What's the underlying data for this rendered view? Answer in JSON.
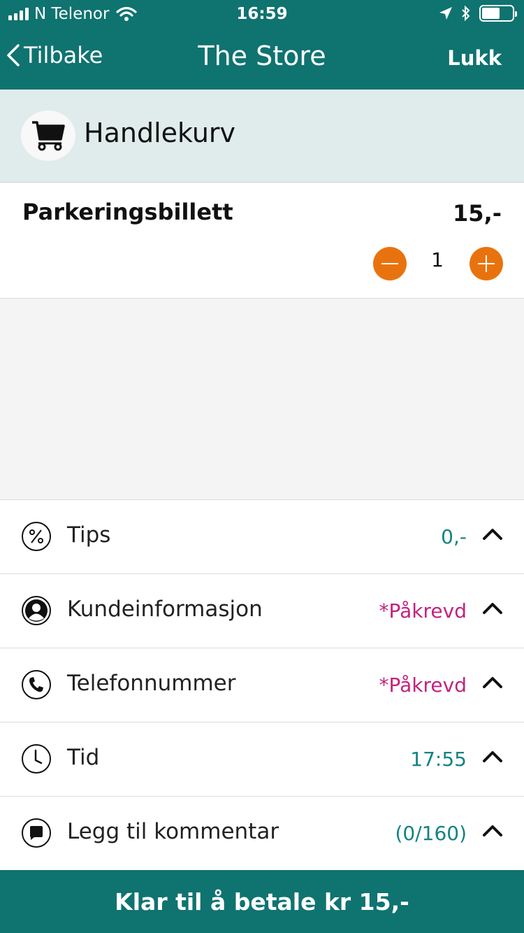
{
  "status_bar": {
    "carrier": "N Telenor",
    "time": "16:59",
    "battery_level": 0.6
  },
  "nav": {
    "back_label": "Tilbake",
    "title": "The Store",
    "close_label": "Lukk"
  },
  "cart": {
    "title": "Handlekurv",
    "icon": "shopping-cart-icon"
  },
  "item": {
    "name": "Parkeringsbillett",
    "price": "15,-",
    "quantity": "1"
  },
  "options": [
    {
      "label": "Tips",
      "value": "0,-",
      "value_color": "teal",
      "icon": "percent-icon"
    },
    {
      "label": "Kundeinformasjon",
      "value": "*Påkrevd",
      "value_color": "pink",
      "icon": "user-icon"
    },
    {
      "label": "Telefonnummer",
      "value": "*Påkrevd",
      "value_color": "pink",
      "icon": "phone-icon"
    },
    {
      "label": "Tid",
      "value": "17:55",
      "value_color": "teal",
      "icon": "clock-icon"
    },
    {
      "label": "Legg til kommentar",
      "value": "(0/160)",
      "value_color": "teal",
      "icon": "comment-icon"
    }
  ],
  "pay_button": {
    "label": "Klar til å betale kr 15,-"
  },
  "colors": {
    "brand": "#0f7370",
    "accent": "#e8730e",
    "required": "#c2237f",
    "value": "#148383"
  }
}
